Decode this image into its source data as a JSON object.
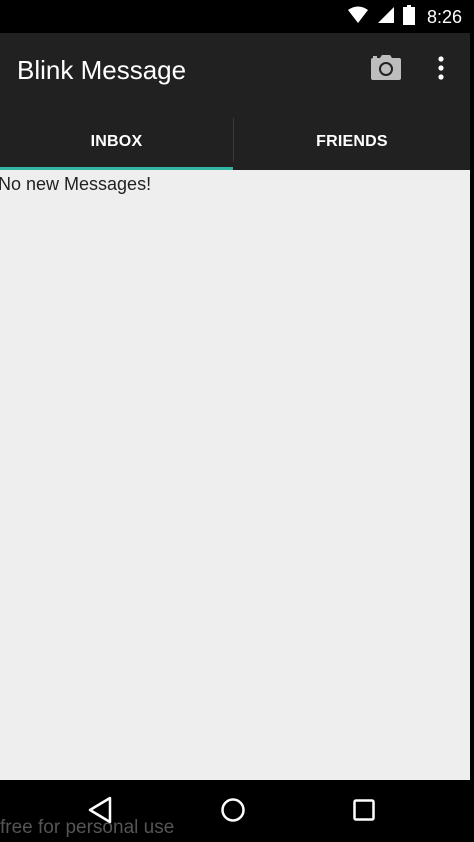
{
  "status_bar": {
    "time": "8:26",
    "icons": [
      "wifi-icon",
      "signal-icon",
      "battery-icon"
    ]
  },
  "app_bar": {
    "title": "Blink Message",
    "actions": [
      "camera-icon",
      "overflow-menu-icon"
    ]
  },
  "tabs": [
    {
      "label": "INBOX",
      "selected": true
    },
    {
      "label": "FRIENDS",
      "selected": false
    }
  ],
  "inbox": {
    "empty_message": "No new Messages!"
  },
  "nav_bar": {
    "buttons": [
      "back-icon",
      "home-icon",
      "recent-apps-icon"
    ]
  },
  "watermark": "free for personal use",
  "colors": {
    "app_bar": "#212121",
    "tab_indicator": "#33b5a5",
    "content_background": "#eeeeee"
  }
}
